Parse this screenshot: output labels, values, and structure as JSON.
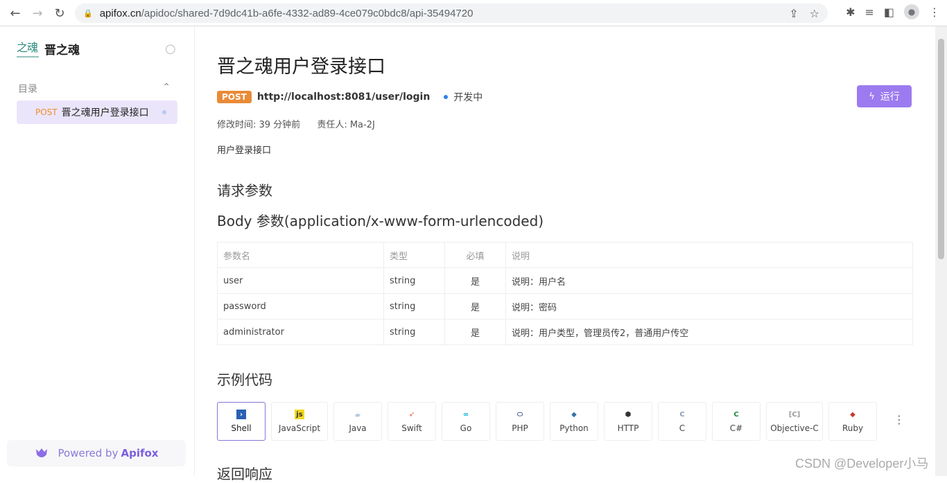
{
  "browser": {
    "url_host": "apifox.cn",
    "url_path": "/apidoc/shared-7d9dc41b-a6fe-4332-ad89-4ce079c0bdc8/api-35494720"
  },
  "sidebar": {
    "brand_name": "晋之魂",
    "toc_label": "目录",
    "items": [
      {
        "method": "POST",
        "label": "晋之魂用户登录接口"
      }
    ],
    "powered_prefix": "Powered by",
    "powered_brand": "Apifox"
  },
  "main": {
    "title": "晋之魂用户登录接口",
    "method": "POST",
    "endpoint": "http://localhost:8081/user/login",
    "status": "开发中",
    "run_label": "运行",
    "modified": "修改时间: 39 分钟前",
    "owner": "责任人: Ma-2J",
    "description": "用户登录接口",
    "request_heading": "请求参数",
    "body_heading": "Body 参数(application/x-www-form-urlencoded)",
    "table": {
      "headers": [
        "参数名",
        "类型",
        "必填",
        "说明"
      ],
      "rows": [
        [
          "user",
          "string",
          "是",
          "说明：用户名"
        ],
        [
          "password",
          "string",
          "是",
          "说明：密码"
        ],
        [
          "administrator",
          "string",
          "是",
          "说明：用户类型，管理员传2，普通用户传空"
        ]
      ]
    },
    "example_heading": "示例代码",
    "languages": [
      "Shell",
      "JavaScript",
      "Java",
      "Swift",
      "Go",
      "PHP",
      "Python",
      "HTTP",
      "C",
      "C#",
      "Objective-C",
      "Ruby"
    ],
    "response_heading": "返回响应"
  },
  "watermark": "CSDN @Developer小马"
}
